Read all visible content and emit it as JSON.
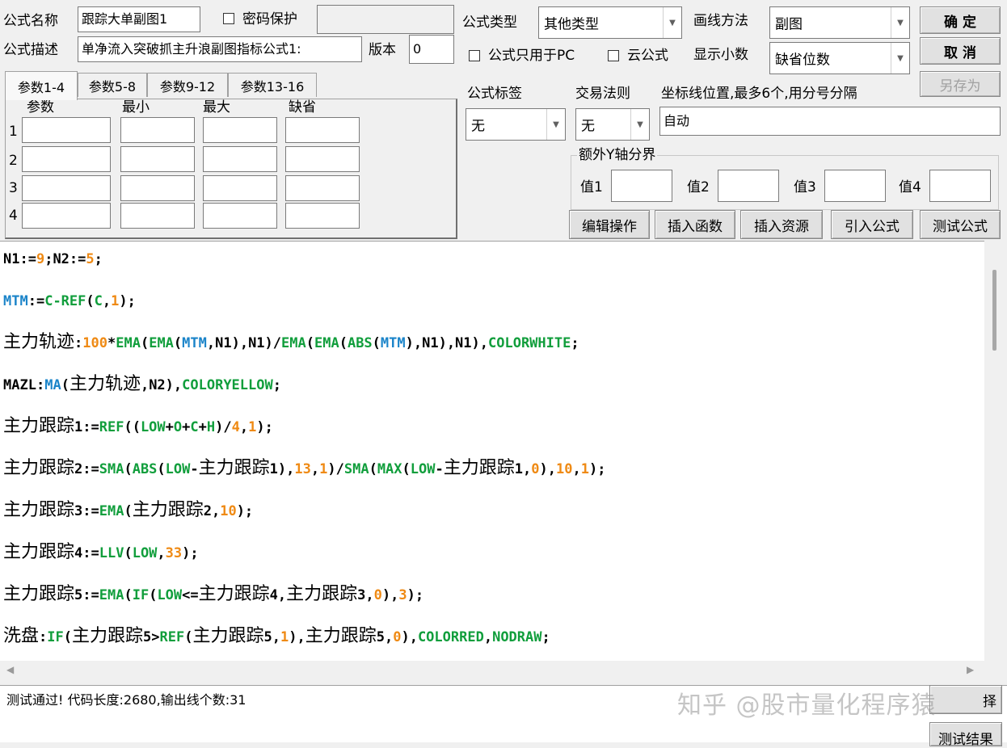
{
  "header": {
    "name_label": "公式名称",
    "name_value": "跟踪大单副图1",
    "password_label": "密码保护",
    "desc_label": "公式描述",
    "desc_value": "单净流入突破抓主升浪副图指标公式1:",
    "version_label": "版本",
    "version_value": "0",
    "type_label": "公式类型",
    "type_value": "其他类型",
    "draw_label": "画线方法",
    "draw_value": "副图",
    "pc_only_label": "公式只用于PC",
    "cloud_label": "云公式",
    "decimals_label": "显示小数",
    "decimals_value": "缺省位数",
    "ok_label": "确  定",
    "cancel_label": "取  消",
    "saveas_label": "另存为"
  },
  "params": {
    "tabs": [
      "参数1-4",
      "参数5-8",
      "参数9-12",
      "参数13-16"
    ],
    "columns": [
      "参数",
      "最小",
      "最大",
      "缺省"
    ],
    "rows": [
      "1",
      "2",
      "3",
      "4"
    ]
  },
  "options": {
    "tag_label": "公式标签",
    "tag_value": "无",
    "rule_label": "交易法则",
    "rule_value": "无",
    "axis_label": "坐标线位置,最多6个,用分号分隔",
    "axis_value": "自动",
    "yaxis_group": "额外Y轴分界",
    "v1": "值1",
    "v2": "值2",
    "v3": "值3",
    "v4": "值4"
  },
  "actions": [
    "编辑操作",
    "插入函数",
    "插入资源",
    "引入公式",
    "测试公式"
  ],
  "code": [
    [
      [
        "N1:=",
        "p"
      ],
      [
        "9",
        "n"
      ],
      [
        ";N2:=",
        "p"
      ],
      [
        "5",
        "n"
      ],
      [
        ";",
        "p"
      ]
    ],
    [
      [
        "MTM",
        "v"
      ],
      [
        ":=",
        "p"
      ],
      [
        "C-REF",
        "f"
      ],
      [
        "(",
        "p"
      ],
      [
        "C",
        "f"
      ],
      [
        ",",
        "p"
      ],
      [
        "1",
        "n"
      ],
      [
        ");",
        "p"
      ]
    ],
    [
      [
        "主力轨迹",
        "c"
      ],
      [
        ":",
        "p"
      ],
      [
        "100",
        "n"
      ],
      [
        "*",
        "p"
      ],
      [
        "EMA",
        "f"
      ],
      [
        "(",
        "p"
      ],
      [
        "EMA",
        "f"
      ],
      [
        "(",
        "p"
      ],
      [
        "MTM",
        "v"
      ],
      [
        ",N1),N1)/",
        "p"
      ],
      [
        "EMA",
        "f"
      ],
      [
        "(",
        "p"
      ],
      [
        "EMA",
        "f"
      ],
      [
        "(",
        "p"
      ],
      [
        "ABS",
        "f"
      ],
      [
        "(",
        "p"
      ],
      [
        "MTM",
        "v"
      ],
      [
        "),N1),N1),",
        "p"
      ],
      [
        "COLORWHITE",
        "f"
      ],
      [
        ";",
        "p"
      ]
    ],
    [
      [
        "MAZL",
        "p"
      ],
      [
        ":",
        "p"
      ],
      [
        "MA",
        "v"
      ],
      [
        "(",
        "p"
      ],
      [
        "主力轨迹",
        "c"
      ],
      [
        ",N2),",
        "p"
      ],
      [
        "COLORYELLOW",
        "f"
      ],
      [
        ";",
        "p"
      ]
    ],
    [
      [
        "主力跟踪",
        "c"
      ],
      [
        "1:=",
        "p"
      ],
      [
        "REF",
        "f"
      ],
      [
        "((",
        "p"
      ],
      [
        "LOW",
        "f"
      ],
      [
        "+",
        "p"
      ],
      [
        "O",
        "f"
      ],
      [
        "+",
        "p"
      ],
      [
        "C",
        "f"
      ],
      [
        "+",
        "p"
      ],
      [
        "H",
        "f"
      ],
      [
        ")/",
        "p"
      ],
      [
        "4",
        "n"
      ],
      [
        ",",
        "p"
      ],
      [
        "1",
        "n"
      ],
      [
        ");",
        "p"
      ]
    ],
    [
      [
        "主力跟踪",
        "c"
      ],
      [
        "2:=",
        "p"
      ],
      [
        "SMA",
        "f"
      ],
      [
        "(",
        "p"
      ],
      [
        "ABS",
        "f"
      ],
      [
        "(",
        "p"
      ],
      [
        "LOW",
        "f"
      ],
      [
        "-",
        "p"
      ],
      [
        "主力跟踪",
        "c"
      ],
      [
        "1),",
        "p"
      ],
      [
        "13",
        "n"
      ],
      [
        ",",
        "p"
      ],
      [
        "1",
        "n"
      ],
      [
        ")/",
        "p"
      ],
      [
        "SMA",
        "f"
      ],
      [
        "(",
        "p"
      ],
      [
        "MAX",
        "f"
      ],
      [
        "(",
        "p"
      ],
      [
        "LOW",
        "f"
      ],
      [
        "-",
        "p"
      ],
      [
        "主力跟踪",
        "c"
      ],
      [
        "1,",
        "p"
      ],
      [
        "0",
        "n"
      ],
      [
        "),",
        "p"
      ],
      [
        "10",
        "n"
      ],
      [
        ",",
        "p"
      ],
      [
        "1",
        "n"
      ],
      [
        ");",
        "p"
      ]
    ],
    [
      [
        "主力跟踪",
        "c"
      ],
      [
        "3:=",
        "p"
      ],
      [
        "EMA",
        "f"
      ],
      [
        "(",
        "p"
      ],
      [
        "主力跟踪",
        "c"
      ],
      [
        "2,",
        "p"
      ],
      [
        "10",
        "n"
      ],
      [
        ");",
        "p"
      ]
    ],
    [
      [
        "主力跟踪",
        "c"
      ],
      [
        "4:=",
        "p"
      ],
      [
        "LLV",
        "f"
      ],
      [
        "(",
        "p"
      ],
      [
        "LOW",
        "f"
      ],
      [
        ",",
        "p"
      ],
      [
        "33",
        "n"
      ],
      [
        ");",
        "p"
      ]
    ],
    [
      [
        "主力跟踪",
        "c"
      ],
      [
        "5:=",
        "p"
      ],
      [
        "EMA",
        "f"
      ],
      [
        "(",
        "p"
      ],
      [
        "IF",
        "f"
      ],
      [
        "(",
        "p"
      ],
      [
        "LOW",
        "f"
      ],
      [
        "<=",
        "p"
      ],
      [
        "主力跟踪",
        "c"
      ],
      [
        "4,",
        "p"
      ],
      [
        "主力跟踪",
        "c"
      ],
      [
        "3,",
        "p"
      ],
      [
        "0",
        "n"
      ],
      [
        "),",
        "p"
      ],
      [
        "3",
        "n"
      ],
      [
        ");",
        "p"
      ]
    ],
    [
      [
        "洗盘",
        "c"
      ],
      [
        ":",
        "p"
      ],
      [
        "IF",
        "f"
      ],
      [
        "(",
        "p"
      ],
      [
        "主力跟踪",
        "c"
      ],
      [
        "5>",
        "p"
      ],
      [
        "REF",
        "f"
      ],
      [
        "(",
        "p"
      ],
      [
        "主力跟踪",
        "c"
      ],
      [
        "5,",
        "p"
      ],
      [
        "1",
        "n"
      ],
      [
        "),",
        "p"
      ],
      [
        "主力跟踪",
        "c"
      ],
      [
        "5,",
        "p"
      ],
      [
        "0",
        "n"
      ],
      [
        "),",
        "p"
      ],
      [
        "COLORRED",
        "f"
      ],
      [
        ",",
        "p"
      ],
      [
        "NODRAW",
        "f"
      ],
      [
        ";",
        "p"
      ]
    ]
  ],
  "status": {
    "message": "测试通过! 代码长度:2680,输出线个数:31",
    "watermark": "知乎 @股市量化程序猿",
    "side_button_1": "择",
    "side_button_2": "测试结果"
  }
}
